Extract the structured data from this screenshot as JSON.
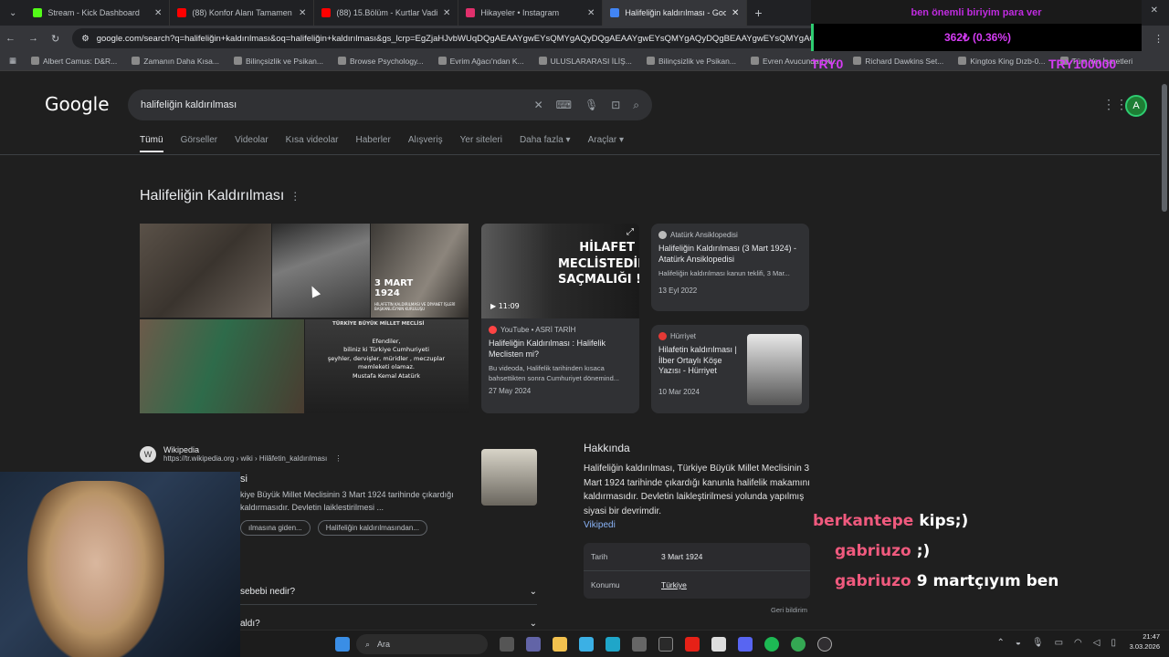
{
  "browser": {
    "tabs": [
      {
        "label": "Stream - Kick Dashboard",
        "color": "#53fc18"
      },
      {
        "label": "(88) Konfor Alanı Tamamen Bi",
        "color": "#ff0000"
      },
      {
        "label": "(88) 15.Bölüm - Kurtlar Vadisi",
        "color": "#ff0000"
      },
      {
        "label": "Hikayeler • Instagram",
        "color": "#e1306c"
      },
      {
        "label": "Halifeliğin kaldırılması - Google",
        "color": "#4285f4",
        "active": true
      }
    ],
    "new_tab": "+",
    "url": "google.com/search?q=halifeliğin+kaldırılması&oq=halifeliğin+kaldırılması&gs_lcrp=EgZjaHJvbWUqDQgAEAAYgwEYsQMYgAQyDQgAEAAYgwEYsQMYgAQyDQgBEAAYgwEYsQMYgAQ",
    "bookmarks": [
      "Albert Camus: D&R...",
      "Zamanın Daha Kısa...",
      "Bilinçsizlik ve Psikan...",
      "Browse Psychology...",
      "Evrim Ağacı'ndan K...",
      "ULUSLARARASI İLİŞ...",
      "Bilinçsizlik ve Psikan...",
      "Evren Avucunda | Ki...",
      "Richard Dawkins Set...",
      "Kingtos King Dızb-0...",
      "Tüm Yer İşaretleri"
    ]
  },
  "stream_overlay": {
    "donate_text": "ben önemli biriyim para ver",
    "goal_text": "362₺ (0.36%)",
    "goal_left": "TRY0",
    "goal_right": "TRY100000"
  },
  "google": {
    "logo": "Google",
    "query": "halifeliğin kaldırılması",
    "avatar": "A",
    "nav": [
      "Tümü",
      "Görseller",
      "Videolar",
      "Kısa videolar",
      "Haberler",
      "Alışveriş",
      "Yer siteleri",
      "Daha fazla ▾",
      "Araçlar ▾"
    ],
    "kp_title": "Halifeliğin Kaldırılması",
    "image_texts": {
      "march": "3 MART\n1924",
      "march_caption": "HİLAFETİN KALDIRILMASI VE DİYANET İŞLERİ BAŞKANLIĞI'NIN KURULUŞU",
      "meclis_title": "TÜRKİYE BÜYÜK MİLLET MECLİSİ",
      "quote": "Efendiler,\nbiliniz ki Türkiye Cumhuriyeti\nşeyhler, dervişler, müridler , meczuplar\nmemleketi olamaz.\nMustafa Kemal Atatürk",
      "video_overlay": "HİLAFET\nMECLİSTEDİR\nSAÇMALIĞI !",
      "video_duration": "▶ 11:09"
    },
    "cards": [
      {
        "source": "Atatürk Ansiklopedisi",
        "title": "Halifeliğin Kaldırılması (3 Mart 1924) - Atatürk Ansiklopedisi",
        "snippet": "Halifeliğin kaldırılması kanun teklifi, 3 Mar...",
        "date": "13 Eyl 2022"
      },
      {
        "source": "YouTube • ASRİ TARİH",
        "title": "Halifeliğin Kaldırılması : Halifelik Meclisten mi?",
        "snippet": "Bu videoda, Halifelik tarihinden kısaca bahsettikten sonra Cumhuriyet dönemind...",
        "date": "27 May 2024"
      },
      {
        "source": "Hürriyet",
        "title": "Hilafetin kaldırılması | İlber Ortaylı Köşe Yazısı - Hürriyet",
        "date": "10 Mar 2024"
      }
    ],
    "wiki": {
      "logo": "W",
      "name": "Wikipedia",
      "url": "https://tr.wikipedia.org › wiki › Hilâfetin_kaldırılması",
      "title": "si",
      "snippet": "kiye Büyük Millet Meclisinin 3 Mart 1924 tarihinde çıkardığı kaldırmasıdır. Devletin laiklestirilmesi ...",
      "chips": [
        "ılmasına giden...",
        "Halifeliğin kaldırılmasından..."
      ]
    },
    "paa": [
      "sebebi nedir?",
      "aldı?"
    ],
    "about": {
      "heading": "Hakkında",
      "text": "Halifeliğin kaldırılması, Türkiye Büyük Millet Meclisinin 3 Mart 1924 tarihinde çıkardığı kanunla halifelik makamını kaldırmasıdır. Devletin laikleştirilmesi yolunda yapılmış siyasi bir devrimdir.",
      "link": "Vikipedi",
      "facts": [
        {
          "k": "Tarih",
          "v": "3 Mart 1924"
        },
        {
          "k": "Konumu",
          "v": "Türkiye"
        }
      ],
      "feedback": "Geri bildirim"
    }
  },
  "chat": [
    {
      "user": "berkantepe",
      "msg": "kips;)"
    },
    {
      "user": "gabriuzo",
      "msg": ";)"
    },
    {
      "user": "gabriuzo",
      "msg": "9 martçıyım ben"
    }
  ],
  "taskbar": {
    "search_placeholder": "Ara",
    "time": "21:47",
    "date": "3.03.2026"
  }
}
